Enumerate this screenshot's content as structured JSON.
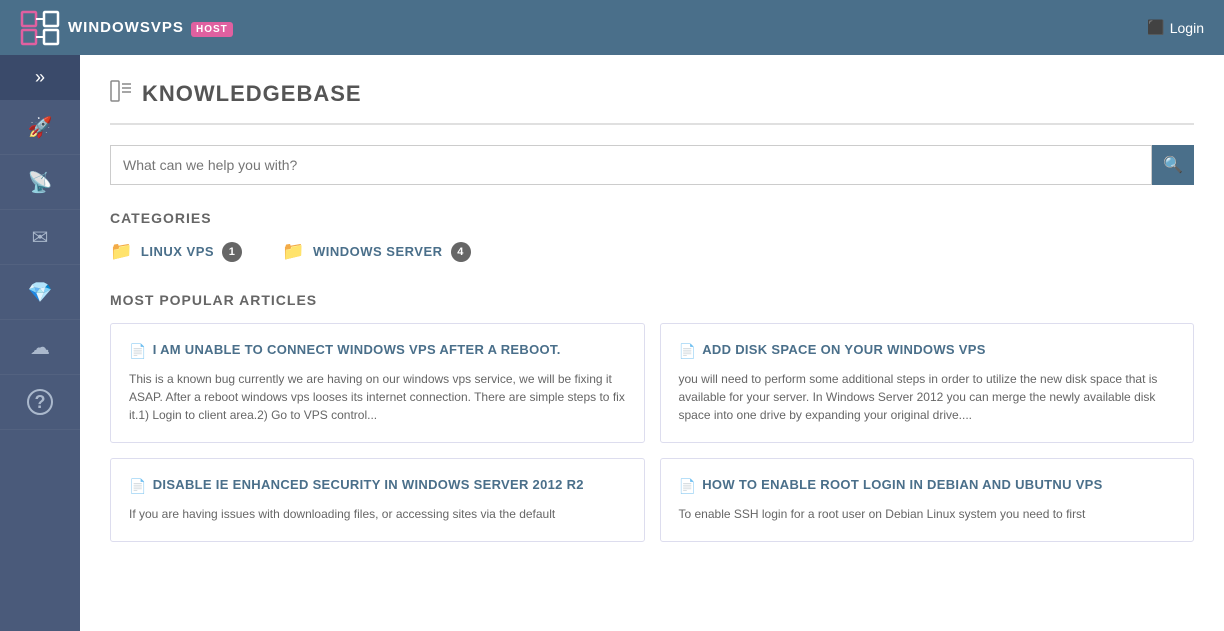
{
  "header": {
    "logo_text": "WINDOWSVPS",
    "logo_badge": "HOST",
    "login_label": "Login"
  },
  "sidebar": {
    "toggle_icon": "»",
    "items": [
      {
        "icon": "🚀",
        "label": "dashboard",
        "active": false
      },
      {
        "icon": "📡",
        "label": "services",
        "active": false
      },
      {
        "icon": "✉",
        "label": "messages",
        "active": false
      },
      {
        "icon": "💎",
        "label": "billing",
        "active": false
      },
      {
        "icon": "☁",
        "label": "cloud",
        "active": false
      },
      {
        "icon": "?",
        "label": "support",
        "active": false
      }
    ]
  },
  "page": {
    "title": "KNOWLEDGEBASE",
    "title_icon": "📋"
  },
  "search": {
    "placeholder": "What can we help you with?",
    "search_icon": "🔍"
  },
  "categories_section": {
    "label": "CATEGORIES",
    "items": [
      {
        "icon": "📁",
        "label": "LINUX VPS",
        "count": "1"
      },
      {
        "icon": "📁",
        "label": "WINDOWS SERVER",
        "count": "4"
      }
    ]
  },
  "popular_section": {
    "label": "MOST POPULAR ARTICLES",
    "articles": [
      {
        "icon": "📄",
        "title": "I AM UNABLE TO CONNECT WINDOWS VPS AFTER A REBOOT.",
        "excerpt": "This is a known bug currently we are having on our windows vps service, we will be fixing it ASAP. After a reboot windows vps looses its internet connection. There are simple steps to fix it.1) Login to client area.2) Go to VPS control..."
      },
      {
        "icon": "📄",
        "title": "ADD DISK SPACE ON YOUR WINDOWS VPS",
        "excerpt": "you will need to perform some additional steps in order to utilize the new disk space that is available for your server. In Windows Server 2012 you can merge the newly available disk space into one drive by expanding your original drive...."
      },
      {
        "icon": "📄",
        "title": "DISABLE IE ENHANCED SECURITY IN WINDOWS SERVER 2012 R2",
        "excerpt": "If you are having issues with downloading files, or accessing sites via the default"
      },
      {
        "icon": "📄",
        "title": "HOW TO ENABLE ROOT LOGIN IN DEBIAN AND UBUTNU VPS",
        "excerpt": "To enable SSH login for a root user on Debian Linux system you need to first"
      }
    ]
  }
}
